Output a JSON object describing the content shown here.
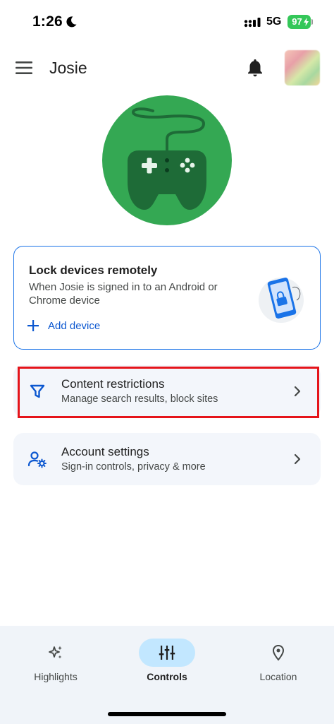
{
  "status_bar": {
    "time": "1:26",
    "network": "5G",
    "battery": "97"
  },
  "app_bar": {
    "title": "Josie",
    "menu_icon": "hamburger-menu-icon",
    "notification_icon": "bell-icon"
  },
  "hero": {
    "icon": "game-controller-icon",
    "background_color": "#34a853"
  },
  "lock_card": {
    "title": "Lock devices remotely",
    "description": "When Josie is signed in to an Android or Chrome device",
    "action_label": "Add device",
    "accent_color": "#1a73e8"
  },
  "rows": [
    {
      "title": "Content restrictions",
      "subtitle": "Manage search results, block sites",
      "icon": "filter-icon"
    },
    {
      "title": "Account settings",
      "subtitle": "Sign-in controls, privacy & more",
      "icon": "account-settings-icon"
    }
  ],
  "bottom_nav": {
    "items": [
      {
        "label": "Highlights",
        "icon": "sparkle-icon",
        "active": false
      },
      {
        "label": "Controls",
        "icon": "sliders-icon",
        "active": true
      },
      {
        "label": "Location",
        "icon": "location-pin-icon",
        "active": false
      }
    ],
    "active_color": "#c2e7ff"
  },
  "annotation": {
    "highlight_color": "#e5141a"
  }
}
